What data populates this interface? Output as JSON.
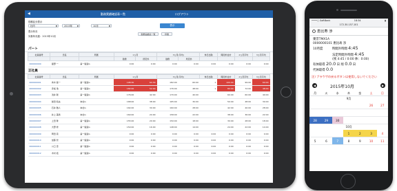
{
  "tablet": {
    "header": {
      "back": "◀",
      "title": "勤務実績確認表一覧",
      "logout": "ログアウト"
    },
    "form": {
      "dept_label": "勤務区分表示",
      "dept_value": "社内",
      "year_label": "表示年月",
      "year_value": "2015年",
      "month_label": "月",
      "month_value": "10月",
      "updated": "対象年月度：2015年10月",
      "show_button": "表示",
      "csv_button": "勤務実績表一覧",
      "print_button": "印刷"
    },
    "section_part": "パート",
    "section_regular": "正社員",
    "columns": {
      "code": "社員番号",
      "name": "氏名",
      "post": "所属",
      "m1": "1ヵ月",
      "m3": "3ヵ月(平均)",
      "work": "勤務",
      "over": "所定外",
      "rest": "休日出勤",
      "overtime": "時間外合計",
      "avg1": "2ヵ月平均",
      "avg2": "3ヵ月平均"
    },
    "part_rows": [
      {
        "code": "000000000",
        "name": "星野 一",
        "post": "第一製造G",
        "vals": [
          "0:00",
          "0:00",
          "0:00",
          "0:00",
          "0:00",
          "0:00",
          "0:00",
          "0:00"
        ]
      }
    ],
    "rows": [
      {
        "code": "000000001",
        "name": "青木 健一",
        "post": "第一製造G",
        "vals": [
          "198:30",
          "64:30",
          "182:00",
          "60:00",
          "1",
          "100:00",
          "99:00",
          "60:00"
        ],
        "hot": true
      },
      {
        "code": "000000002",
        "name": "赤坂 浩",
        "post": "第一製造G",
        "vals": [
          "182:00",
          "52:00",
          "176:00",
          "48:00",
          "1",
          "80:00",
          "72:00",
          "48:00"
        ],
        "hot": true
      },
      {
        "code": "000000003",
        "name": "浅井 聡",
        "post": "第一製造G",
        "vals": [
          "176:00",
          "42:00",
          "170:00",
          "40:00",
          "",
          "60:00",
          "60:00",
          "40:00"
        ],
        "hot": false
      },
      {
        "code": "000000004",
        "name": "飯田 和夫",
        "post": "本社G",
        "vals": [
          "168:00",
          "38:00",
          "165:00",
          "30:00",
          "",
          "50:00",
          "48:00",
          "30:00"
        ],
        "hot": false
      },
      {
        "code": "000000005",
        "name": "石井 雅人",
        "post": "本社G",
        "vals": [
          "164:00",
          "30:00",
          "160:00",
          "28:00",
          "",
          "42:00",
          "40:00",
          "28:00"
        ],
        "hot": false
      },
      {
        "code": "000000006",
        "name": "井上 美香",
        "post": "本社G",
        "vals": [
          "160:00",
          "24:00",
          "158:00",
          "22:00",
          "",
          "38:00",
          "36:00",
          "22:00"
        ],
        "hot": false
      },
      {
        "code": "000000007",
        "name": "上田 隆",
        "post": "第一製造G",
        "vals": [
          "155:00",
          "20:00",
          "150:00",
          "18:00",
          "",
          "30:00",
          "28:00",
          "18:00"
        ],
        "hot": false
      },
      {
        "code": "000000008",
        "name": "大野 修",
        "post": "第一製造G",
        "vals": [
          "150:00",
          "16:00",
          "148:00",
          "14:00",
          "",
          "24:00",
          "22:00",
          "14:00"
        ],
        "hot": false
      },
      {
        "code": "000000009",
        "name": "岡田 真",
        "post": "第一製造G",
        "vals": "0:00"
      },
      {
        "code": "000000010",
        "name": "加藤 智",
        "post": "第一製造G",
        "vals": "0:00"
      },
      {
        "code": "000000011",
        "name": "川口 恵",
        "post": "第一製造G",
        "vals": "0:00"
      },
      {
        "code": "000000012",
        "name": "木村 拓",
        "post": "第一製造G",
        "vals": "0:00"
      }
    ]
  },
  "phone": {
    "carrier": "••••○ SoftBank",
    "time": "18:34",
    "battery": "▮",
    "url": "172.30.157.101",
    "name": "恵比寿 渉",
    "company": "東京TMX1A",
    "emp": "0000000101 恵比寿 渉",
    "month": "10月度",
    "work_label": "時間外時間",
    "work_value": "4:45",
    "legal_label": "法定時間外時間",
    "legal_value": "4:45",
    "detail": "(残 4:45 / 0:00 休：0:00)",
    "paid_label": "有休取得",
    "paid_value": "20.0",
    "remain_label": "日 残",
    "remain_value": "0.0",
    "remain_unit": "日",
    "sub_label": "代休取得",
    "sub_value": "0.0",
    "warning": "注) ブラウザの戻るボタンは使用しないでください",
    "calendar": {
      "title": "2015年10月",
      "weekdays": [
        "月",
        "火",
        "水",
        "木",
        "金",
        "土",
        "日"
      ],
      "month_label": "9月",
      "month2_label": "10月"
    }
  }
}
